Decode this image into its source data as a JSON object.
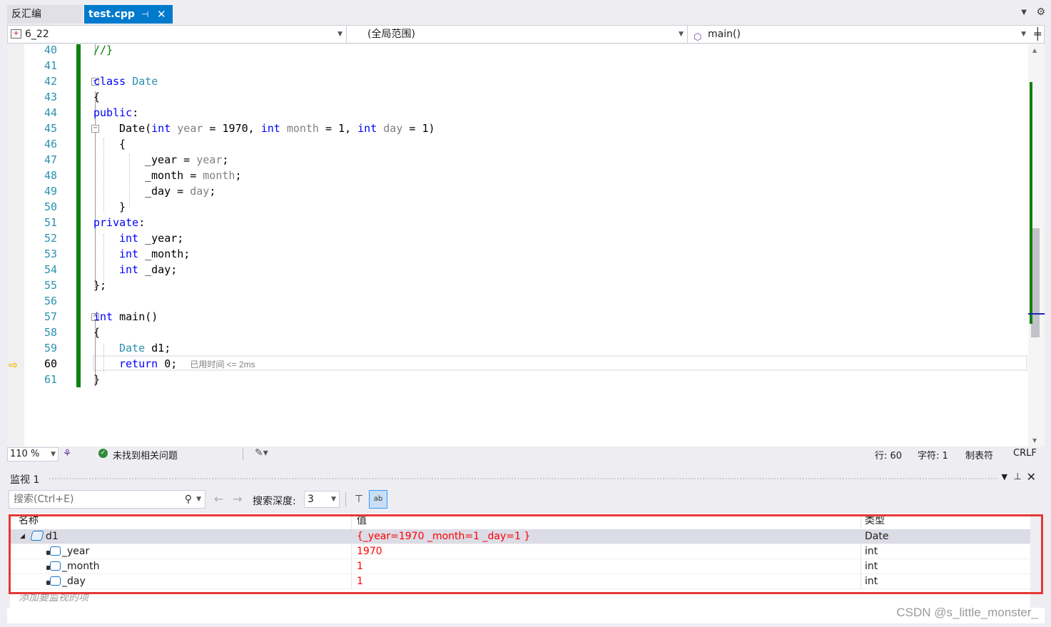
{
  "tabs": {
    "disasm": "反汇编",
    "active": "test.cpp",
    "pin_icon": "pin-icon",
    "close_icon": "close-icon"
  },
  "navbar": {
    "project": "6_22",
    "scope": "(全局范围)",
    "function": "main()"
  },
  "editor": {
    "line_numbers": [
      "40",
      "41",
      "42",
      "43",
      "44",
      "45",
      "46",
      "47",
      "48",
      "49",
      "50",
      "51",
      "52",
      "53",
      "54",
      "55",
      "56",
      "57",
      "58",
      "59",
      "60",
      "61"
    ],
    "current_line": "60",
    "time_hint": "已用时间 <= 2ms",
    "code": {
      "l40": "//}",
      "l42_kw": "class",
      "l42_ty": "Date",
      "l43": "{",
      "l44_kw": "public",
      "l44_p": ":",
      "l45_fn": "Date(",
      "l45_int1": "int",
      "l45_year": "year",
      "l45_eq1": " = 1970, ",
      "l45_int2": "int",
      "l45_month": "month",
      "l45_eq2": " = 1, ",
      "l45_int3": "int",
      "l45_day": "day",
      "l45_eq3": " = 1)",
      "l46": "{",
      "l47_a": "_year = ",
      "l47_b": "year",
      "l47_c": ";",
      "l48_a": "_month = ",
      "l48_b": "month",
      "l48_c": ";",
      "l49_a": "_day = ",
      "l49_b": "day",
      "l49_c": ";",
      "l50": "}",
      "l51_kw": "private",
      "l51_p": ":",
      "l52_kw": "int",
      "l52_id": " _year;",
      "l53_kw": "int",
      "l53_id": " _month;",
      "l54_kw": "int",
      "l54_id": " _day;",
      "l55": "};",
      "l57_kw": "int",
      "l57_id": " main()",
      "l58": "{",
      "l59_ty": "Date",
      "l59_id": " d1;",
      "l60_kw": "return",
      "l60_id": " 0;",
      "l61": "}"
    }
  },
  "statusbar": {
    "zoom": "110 %",
    "issues": "未找到相关问题",
    "line": "行: 60",
    "char": "字符: 1",
    "tabs": "制表符",
    "eol": "CRLF"
  },
  "watch": {
    "title": "监视 1",
    "search_placeholder": "搜索(Ctrl+E)",
    "depth_label": "搜索深度:",
    "depth_value": "3",
    "columns": {
      "name": "名称",
      "value": "值",
      "type": "类型"
    },
    "rows": [
      {
        "name": "d1",
        "value": "{_year=1970 _month=1 _day=1 }",
        "type": "Date"
      },
      {
        "name": "_year",
        "value": "1970",
        "type": "int"
      },
      {
        "name": "_month",
        "value": "1",
        "type": "int"
      },
      {
        "name": "_day",
        "value": "1",
        "type": "int"
      }
    ],
    "add_item": "添加要监视的项"
  },
  "watermark": "CSDN @s_little_monster_",
  "colors": {
    "accent": "#007acc",
    "keyword": "#0000ff",
    "type": "#2b91af",
    "value_changed": "#ff0000",
    "highlight_box": "#e53935"
  }
}
